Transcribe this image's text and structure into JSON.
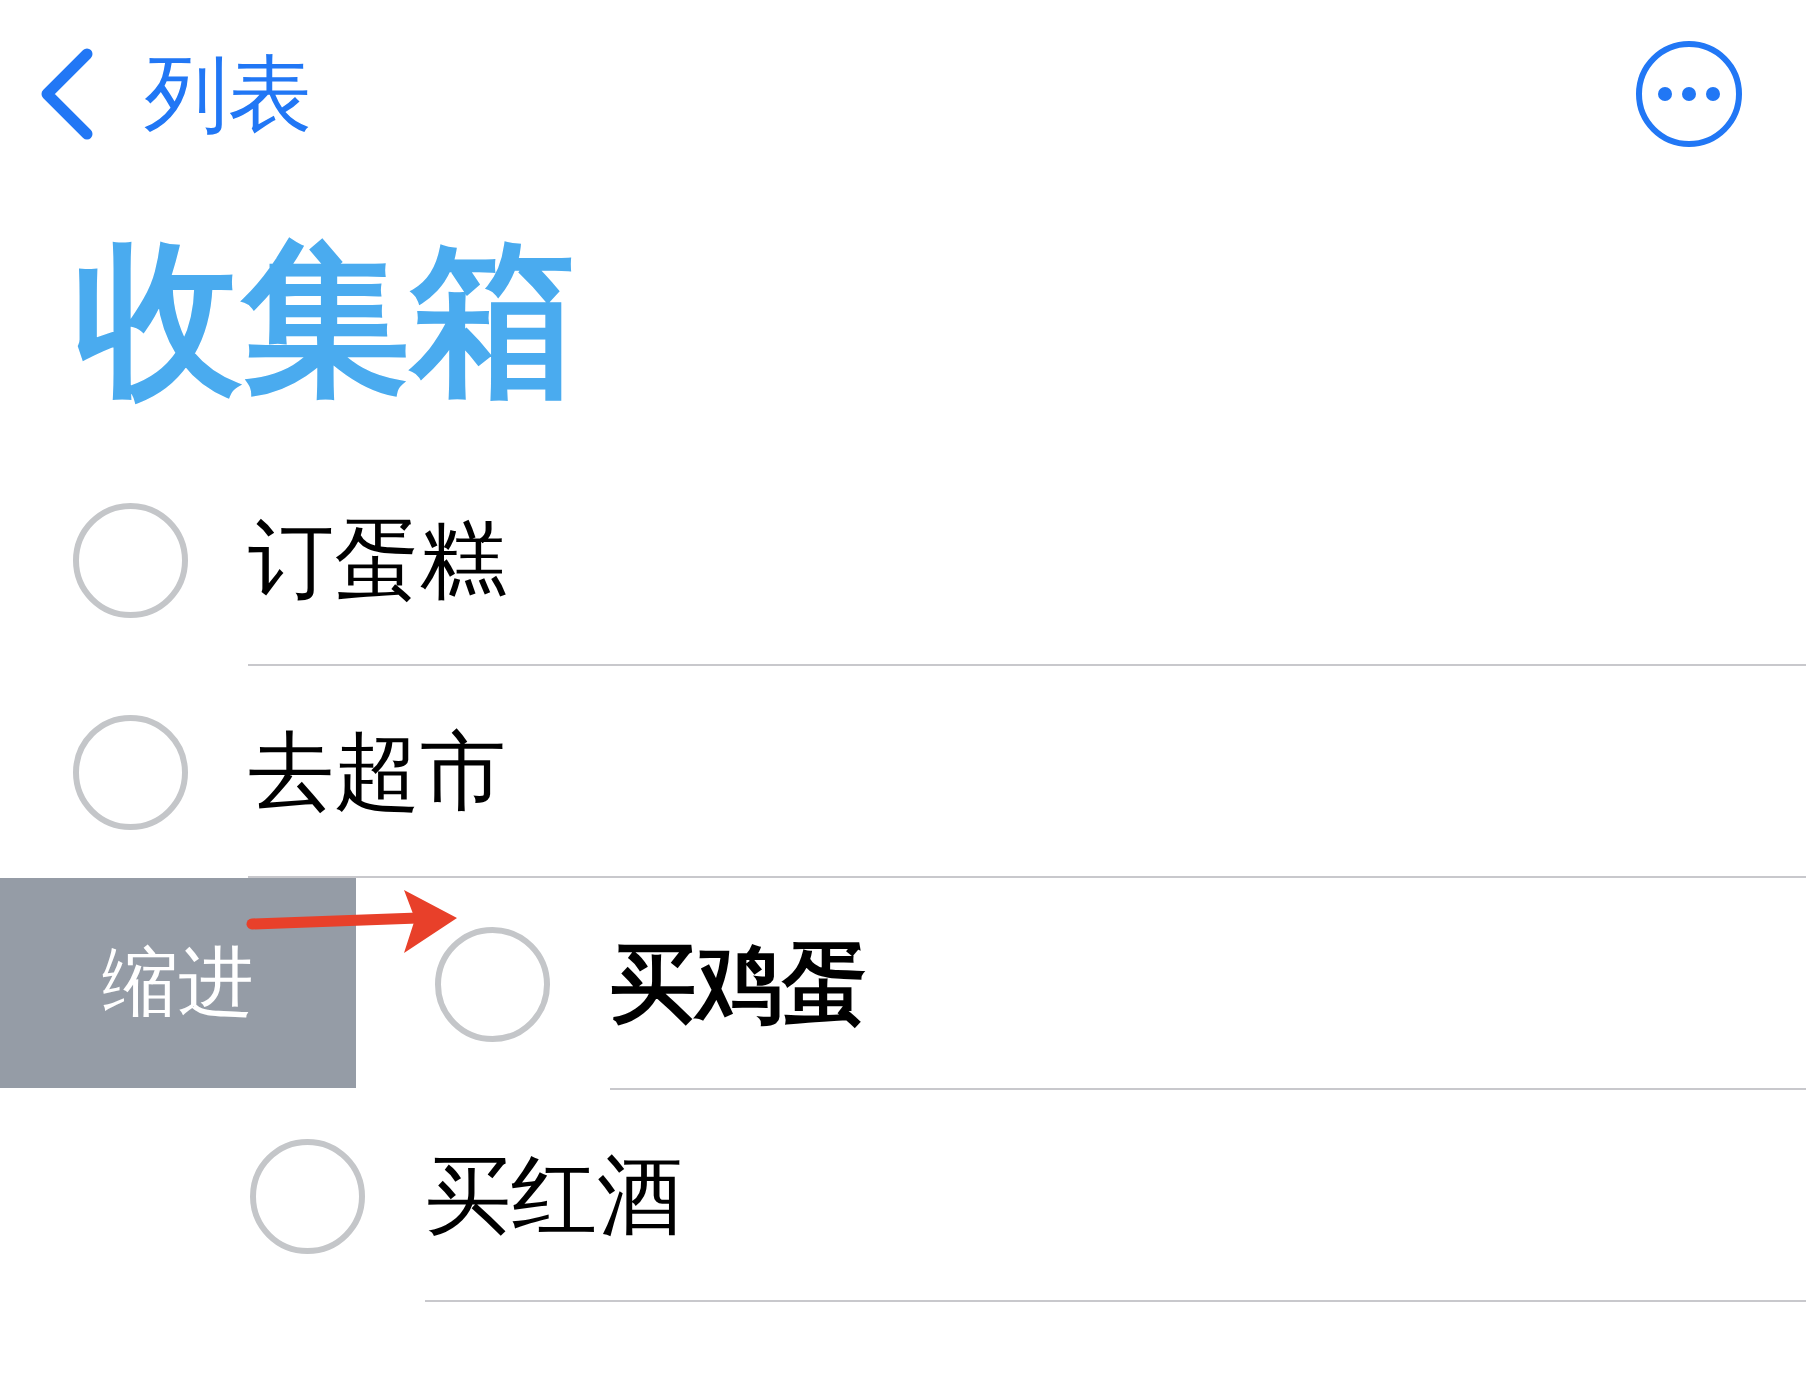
{
  "nav": {
    "back_label": "列表"
  },
  "title": "收集箱",
  "reminders": [
    {
      "title": "订蛋糕",
      "checked": false
    },
    {
      "title": "去超市",
      "checked": false
    },
    {
      "title": "买鸡蛋",
      "checked": false,
      "swipe_action": "缩进",
      "children": [
        {
          "title": "买红酒",
          "checked": false
        }
      ]
    }
  ]
}
